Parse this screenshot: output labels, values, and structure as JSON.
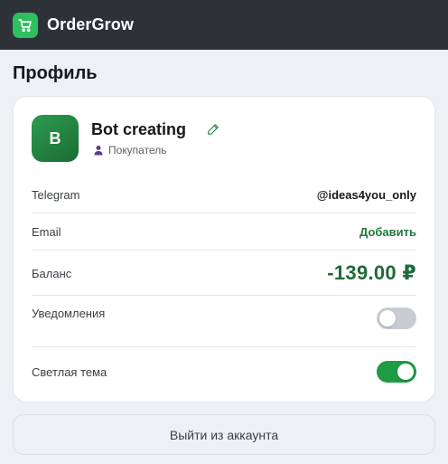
{
  "app": {
    "brand": "OrderGrow",
    "logo_icon": "cart-icon",
    "brand_color": "#2fbf5e",
    "header_bg": "#2d3238"
  },
  "page": {
    "title": "Профиль"
  },
  "profile": {
    "avatar_letter": "B",
    "name": "Bot creating",
    "edit_icon": "pencil-icon",
    "role_icon": "person-icon",
    "role": "Покупатель"
  },
  "fields": {
    "telegram": {
      "label": "Telegram",
      "value": "@ideas4you_only"
    },
    "email": {
      "label": "Email",
      "action": "Добавить"
    },
    "balance": {
      "label": "Баланс",
      "value": "-139.00 ₽",
      "color": "#1f6b36"
    },
    "notifications": {
      "label": "Уведомления",
      "enabled": false
    },
    "light_theme": {
      "label": "Светлая тема",
      "enabled": true,
      "accent": "#1f9a45"
    }
  },
  "logout": {
    "label": "Выйти из аккаунта"
  }
}
